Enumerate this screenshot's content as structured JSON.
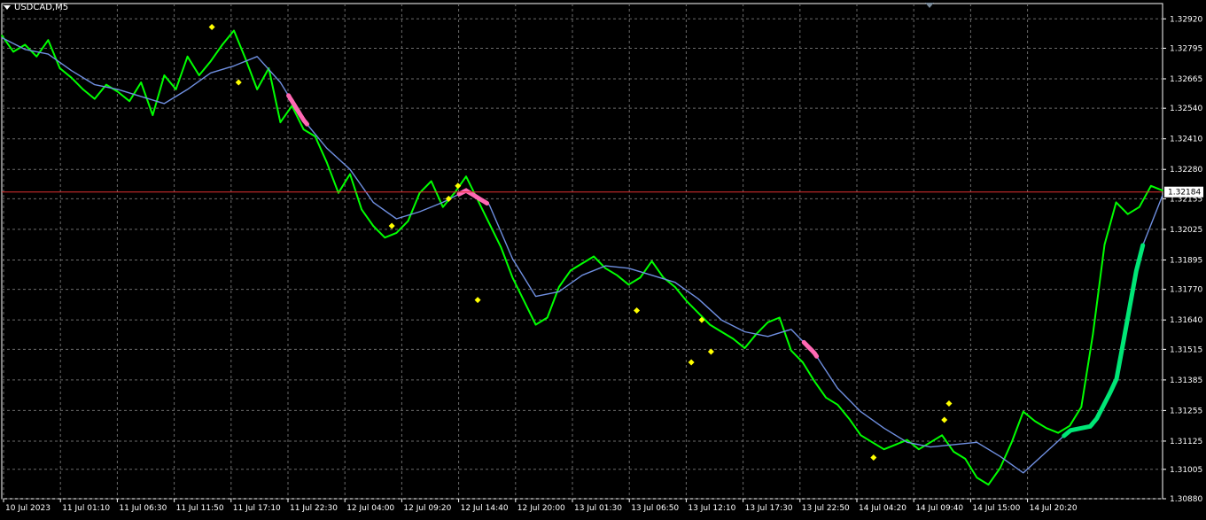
{
  "chart_data": {
    "type": "line",
    "title": "USDCAD,M5",
    "xlabel": "",
    "ylabel": "",
    "ylim": [
      1.3088,
      1.32985
    ],
    "grid": true,
    "current_price": "1.32184",
    "yticks": [
      "1.32920",
      "1.32795",
      "1.32665",
      "1.32540",
      "1.32410",
      "1.32280",
      "1.32155",
      "1.32025",
      "1.31895",
      "1.31770",
      "1.31640",
      "1.31515",
      "1.31385",
      "1.31255",
      "1.31125",
      "1.31005",
      "1.30880"
    ],
    "xticks": [
      "10 Jul 2023",
      "11 Jul 01:10",
      "11 Jul 06:30",
      "11 Jul 11:50",
      "11 Jul 17:10",
      "11 Jul 22:30",
      "12 Jul 04:00",
      "12 Jul 09:20",
      "12 Jul 14:40",
      "12 Jul 20:00",
      "13 Jul 01:30",
      "13 Jul 06:50",
      "13 Jul 12:10",
      "13 Jul 17:30",
      "13 Jul 22:50",
      "14 Jul 04:20",
      "14 Jul 09:40",
      "14 Jul 15:00",
      "14 Jul 20:20"
    ],
    "series": [
      {
        "name": "",
        "color": "#00ff00",
        "x": [
          0,
          0.01,
          0.02,
          0.03,
          0.04,
          0.05,
          0.06,
          0.07,
          0.08,
          0.09,
          0.1,
          0.11,
          0.12,
          0.13,
          0.14,
          0.15,
          0.16,
          0.17,
          0.18,
          0.19,
          0.2,
          0.21,
          0.22,
          0.23,
          0.24,
          0.25,
          0.26,
          0.27,
          0.28,
          0.29,
          0.3,
          0.31,
          0.32,
          0.33,
          0.34,
          0.35,
          0.36,
          0.37,
          0.38,
          0.39,
          0.4,
          0.41,
          0.42,
          0.43,
          0.44,
          0.45,
          0.46,
          0.47,
          0.48,
          0.49,
          0.5,
          0.51,
          0.52,
          0.53,
          0.54,
          0.55,
          0.56,
          0.57,
          0.58,
          0.59,
          0.6,
          0.61,
          0.62,
          0.63,
          0.64,
          0.65,
          0.66,
          0.67,
          0.68,
          0.69,
          0.7,
          0.71,
          0.72,
          0.73,
          0.74,
          0.75,
          0.76,
          0.77,
          0.78,
          0.79,
          0.8,
          0.81,
          0.82,
          0.83,
          0.84,
          0.85,
          0.86,
          0.87,
          0.88,
          0.89,
          0.9,
          0.91,
          0.92,
          0.93,
          0.94,
          0.95,
          0.96,
          0.97,
          0.98,
          0.99,
          1
        ],
        "values": [
          1.3285,
          1.3278,
          1.3281,
          1.3276,
          1.3283,
          1.3271,
          1.3267,
          1.3262,
          1.3258,
          1.3264,
          1.3261,
          1.3257,
          1.3265,
          1.3251,
          1.3268,
          1.3262,
          1.3276,
          1.3268,
          1.3274,
          1.3281,
          1.3287,
          1.3275,
          1.3262,
          1.3271,
          1.3248,
          1.3255,
          1.3245,
          1.3242,
          1.3231,
          1.3218,
          1.3226,
          1.3211,
          1.3204,
          1.3199,
          1.3201,
          1.3206,
          1.3218,
          1.3223,
          1.3212,
          1.3218,
          1.3225,
          1.3215,
          1.3205,
          1.3195,
          1.3182,
          1.3172,
          1.3162,
          1.3165,
          1.3178,
          1.3185,
          1.3188,
          1.3191,
          1.3186,
          1.3183,
          1.3179,
          1.3182,
          1.3189,
          1.3182,
          1.3178,
          1.3172,
          1.3167,
          1.3162,
          1.3159,
          1.3156,
          1.3152,
          1.3158,
          1.3163,
          1.3165,
          1.3151,
          1.3146,
          1.3138,
          1.3131,
          1.3128,
          1.3122,
          1.3115,
          1.3112,
          1.3109,
          1.3111,
          1.3113,
          1.3109,
          1.3112,
          1.3115,
          1.3108,
          1.3105,
          1.3097,
          1.3094,
          1.3101,
          1.3112,
          1.3125,
          1.3121,
          1.3118,
          1.3116,
          1.3119,
          1.3127,
          1.3158,
          1.3196,
          1.3214,
          1.3209,
          1.3212,
          1.3221,
          1.3219
        ]
      },
      {
        "name": "",
        "color": "#6f8fe0",
        "x": [
          0,
          0.02,
          0.04,
          0.06,
          0.08,
          0.1,
          0.12,
          0.14,
          0.16,
          0.18,
          0.2,
          0.22,
          0.24,
          0.26,
          0.28,
          0.3,
          0.32,
          0.34,
          0.36,
          0.38,
          0.4,
          0.42,
          0.44,
          0.46,
          0.48,
          0.5,
          0.52,
          0.54,
          0.56,
          0.58,
          0.6,
          0.62,
          0.64,
          0.66,
          0.68,
          0.7,
          0.72,
          0.74,
          0.76,
          0.78,
          0.8,
          0.82,
          0.84,
          0.86,
          0.88,
          0.9,
          0.92,
          0.94,
          0.96,
          0.98,
          1
        ],
        "values": [
          1.3284,
          1.3279,
          1.3277,
          1.327,
          1.3264,
          1.3262,
          1.3259,
          1.3256,
          1.3262,
          1.3269,
          1.3272,
          1.3276,
          1.3265,
          1.3249,
          1.3237,
          1.3228,
          1.3214,
          1.3207,
          1.321,
          1.3214,
          1.3219,
          1.3213,
          1.319,
          1.3174,
          1.3176,
          1.3183,
          1.3187,
          1.3186,
          1.3183,
          1.318,
          1.3173,
          1.3164,
          1.3159,
          1.3157,
          1.316,
          1.315,
          1.3135,
          1.3125,
          1.3118,
          1.3112,
          1.311,
          1.3111,
          1.3112,
          1.3106,
          1.3099,
          1.3108,
          1.3117,
          1.3119,
          1.3138,
          1.3192,
          1.3217
        ]
      }
    ],
    "signal_segments": [
      {
        "color": "#ff69b4",
        "x": [
          0.247,
          0.263
        ]
      },
      {
        "color": "#ff69b4",
        "x": [
          0.394,
          0.418
        ]
      },
      {
        "color": "#ff69b4",
        "x": [
          0.691,
          0.702
        ]
      },
      {
        "color": "#00e676",
        "x": [
          0.915,
          0.983
        ]
      }
    ],
    "markers": [
      {
        "x": 0.181,
        "value": 1.32885,
        "color": "#ffff00"
      },
      {
        "x": 0.204,
        "value": 1.3265,
        "color": "#ffff00"
      },
      {
        "x": 0.393,
        "value": 1.3221,
        "color": "#ffff00"
      },
      {
        "x": 0.385,
        "value": 1.32155,
        "color": "#ffff00"
      },
      {
        "x": 0.336,
        "value": 1.3204,
        "color": "#ffff00"
      },
      {
        "x": 0.41,
        "value": 1.31725,
        "color": "#ffff00"
      },
      {
        "x": 0.547,
        "value": 1.3168,
        "color": "#ffff00"
      },
      {
        "x": 0.603,
        "value": 1.3164,
        "color": "#ffff00"
      },
      {
        "x": 0.611,
        "value": 1.31505,
        "color": "#ffff00"
      },
      {
        "x": 0.594,
        "value": 1.3146,
        "color": "#ffff00"
      },
      {
        "x": 0.751,
        "value": 1.31055,
        "color": "#ffff00"
      },
      {
        "x": 0.812,
        "value": 1.31215,
        "color": "#ffff00"
      },
      {
        "x": 0.816,
        "value": 1.31285,
        "color": "#ffff00"
      }
    ]
  }
}
